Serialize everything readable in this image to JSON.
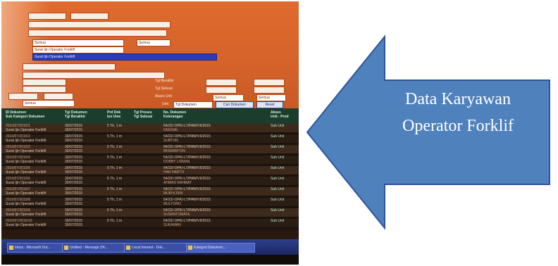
{
  "callout": {
    "line1": "Data Karyawan",
    "line2": "Operator Forklif",
    "fill_color": "#4f81bd",
    "stroke_color": "#2f5597"
  },
  "form": {
    "select_all_1": "Semua",
    "select_all_2": "Semua",
    "select_all_3": "Semua",
    "select_all_4": "Semua",
    "select_all_5": "Semua",
    "doc_type_1": "Surat Ijin Operator Forklift",
    "doc_type_2": "Surat Ijin Operator Forklift",
    "label_tgl_berakhir": "Tgl Berakhir",
    "label_tgl_selesai": "Tgl Selesai",
    "label_akses_unit": "Akses Unit",
    "label_unit": "Unit",
    "unit_select": "Tgl Dokumen",
    "search_button": "Cari Dokumen",
    "reset_button": "Reset"
  },
  "grid": {
    "headers": [
      "ID Dokumen\nSub Kategori Dokumen",
      "Tgl Dokumen\nTgl Berakhir",
      "Prd Dok\nIsn Unw",
      "Tgl Proses\nTgl Selesai",
      "No. Dokumen\nKeterangan",
      "Akses\nUnit - Prod"
    ],
    "rows": [
      {
        "id": "2010/07/2015/1",
        "sub": "Surat Ijin Operator Forklift",
        "date": "30/07/2015",
        "prd": "5 Th, 1 m",
        "no": "54/22/-OPK/-LT/PAW/VII/2015",
        "ket": "DEKISAL",
        "unit": "Sub Unit"
      },
      {
        "id": "2010/07/2015/2",
        "sub": "Surat Ijin Operator Forklift",
        "date": "30/07/2015",
        "prd": "5 Th, 1 m",
        "no": "54/22/-OPK/-LT/PAW/VII/2015",
        "ket": "SUBTON",
        "unit": "Sub Unit"
      },
      {
        "id": "2010/07/2015/3",
        "sub": "Surat Ijin Operator Forklift",
        "date": "30/07/2015",
        "prd": "5 Th, 1 m",
        "no": "54/22/-OPK/-LT/PAW/VII/2015",
        "ket": "MISWANTON",
        "unit": "Sub Unit"
      },
      {
        "id": "2010/07/2015/4",
        "sub": "Surat Ijin Operator Forklift",
        "date": "30/07/2015",
        "prd": "5 Th, 1 m",
        "no": "54/22/-OPK/-LT/PAW/VII/2015",
        "ket": "DOBBY LISMAN",
        "unit": "Sub Unit"
      },
      {
        "id": "2010/07/2015/5",
        "sub": "Surat Ijin Operator Forklift",
        "date": "30/07/2015",
        "prd": "5 Th, 1 m",
        "no": "54/22/-OPK/-LT/PAW/VII/2015",
        "ket": "HAR HARTO",
        "unit": "Sub Unit"
      },
      {
        "id": "2010/07/2015/6",
        "sub": "Surat Ijin Operator Forklift",
        "date": "30/07/2015",
        "prd": "5 Th, 1 m",
        "no": "54/22/-OPK/-LT/PAW/VII/2015",
        "ket": "AHMAD RAHMAT",
        "unit": "Sub Unit"
      },
      {
        "id": "2010/07/2015/7",
        "sub": "Surat Ijin Operator Forklift",
        "date": "30/07/2015",
        "prd": "5 Th, 1 m",
        "no": "54/22/-OPK/-LT/PAW/VII/2015",
        "ket": "MUKHLISIN",
        "unit": "Sub Unit"
      },
      {
        "id": "2010/07/2015/8",
        "sub": "Surat Ijin Operator Forklift",
        "date": "30/07/2015",
        "prd": "5 Th, 1 m",
        "no": "54/22/-OPK/-LT/PAW/VII/2015",
        "ket": "MULYONO",
        "unit": "Sub Unit"
      },
      {
        "id": "2010/07/2015/9",
        "sub": "Surat Ijin Operator Forklift",
        "date": "30/07/2015",
        "prd": "5 Th, 1 m",
        "no": "54/22/-OPK/-LT/PAW/VII/2015",
        "ket": "SUSANTOMATA",
        "unit": "Sub Unit"
      },
      {
        "id": "2010/07/2015/10",
        "sub": "Surat Ijin Operator Forklift",
        "date": "30/07/2015",
        "prd": "5 Th, 1 m",
        "no": "54/22/-OPK/-LT/PAW/VII/2015",
        "ket": "SUKAMAN",
        "unit": "Sub Unit"
      }
    ]
  },
  "taskbar": {
    "items": [
      "Inbox - Microsoft Out...",
      "Untitled - Message (Ht...",
      "Local Intranet - Dok...",
      "Kategori Dokumen..."
    ]
  }
}
